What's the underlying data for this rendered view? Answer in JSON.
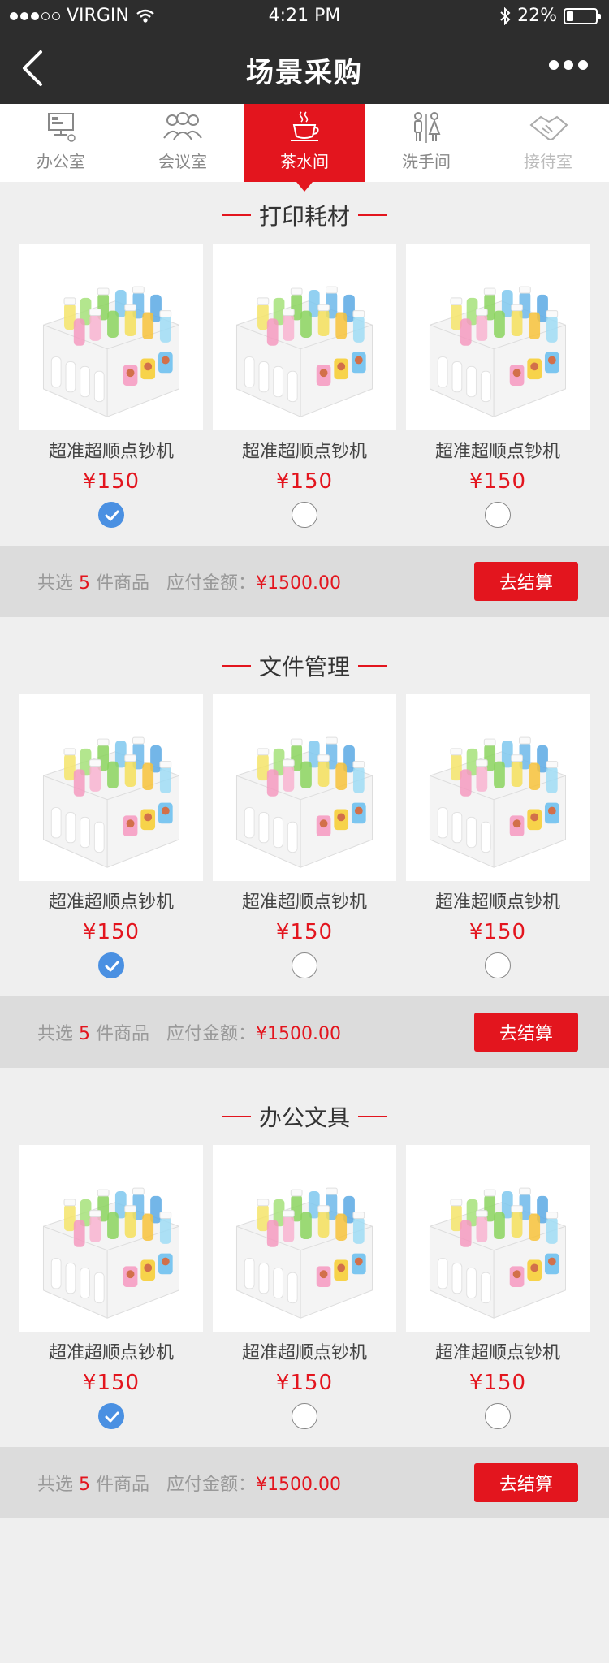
{
  "status_bar": {
    "carrier": "VIRGIN",
    "time": "4:21 PM",
    "battery": "22%"
  },
  "nav": {
    "title": "场景采购"
  },
  "tabs": [
    {
      "label": "办公室",
      "icon": "monitor-icon"
    },
    {
      "label": "会议室",
      "icon": "people-icon"
    },
    {
      "label": "茶水间",
      "icon": "coffee-cup-icon",
      "active": true
    },
    {
      "label": "洗手间",
      "icon": "restroom-icon"
    },
    {
      "label": "接待室",
      "icon": "handshake-icon"
    }
  ],
  "sections": [
    {
      "title": "打印耗材",
      "products": [
        {
          "name": "超准超顺点钞机",
          "price": "¥150",
          "selected": true
        },
        {
          "name": "超准超顺点钞机",
          "price": "¥150",
          "selected": false
        },
        {
          "name": "超准超顺点钞机",
          "price": "¥150",
          "selected": false
        }
      ],
      "summary": {
        "prefix": "共选",
        "count": "5",
        "suffix": "件商品",
        "amount_label": "应付金额：",
        "amount": "¥1500.00"
      },
      "checkout_label": "去结算"
    },
    {
      "title": "文件管理",
      "products": [
        {
          "name": "超准超顺点钞机",
          "price": "¥150",
          "selected": true
        },
        {
          "name": "超准超顺点钞机",
          "price": "¥150",
          "selected": false
        },
        {
          "name": "超准超顺点钞机",
          "price": "¥150",
          "selected": false
        }
      ],
      "summary": {
        "prefix": "共选",
        "count": "5",
        "suffix": "件商品",
        "amount_label": "应付金额：",
        "amount": "¥1500.00"
      },
      "checkout_label": "去结算"
    },
    {
      "title": "办公文具",
      "products": [
        {
          "name": "超准超顺点钞机",
          "price": "¥150",
          "selected": true
        },
        {
          "name": "超准超顺点钞机",
          "price": "¥150",
          "selected": false
        },
        {
          "name": "超准超顺点钞机",
          "price": "¥150",
          "selected": false
        }
      ],
      "summary": {
        "prefix": "共选",
        "count": "5",
        "suffix": "件商品",
        "amount_label": "应付金额：",
        "amount": "¥1500.00"
      },
      "checkout_label": "去结算"
    }
  ],
  "colors": {
    "accent": "#e3151e",
    "check": "#4a90e2",
    "bar": "#2d2d2d"
  }
}
